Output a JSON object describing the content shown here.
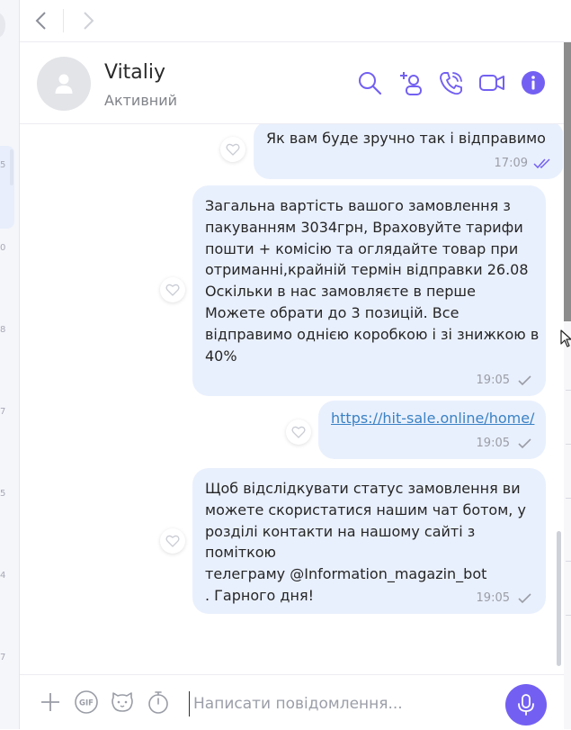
{
  "sidebar_numbers": [
    "5",
    "0",
    "8",
    "7",
    "5",
    "4",
    "7"
  ],
  "header": {
    "contact_name": "Vitaliy",
    "contact_status": "Активний",
    "icons": [
      "search-icon",
      "add-participant-icon",
      "voice-call-icon",
      "video-call-icon",
      "info-icon"
    ]
  },
  "messages": [
    {
      "text": "Як вам буде зручно так і відправимо",
      "time": "17:09",
      "status": "seen"
    },
    {
      "text": "Загальна вартість вашого замовлення з\nпакуванням 3034грн, Враховуйте тарифи\nпошти + комісію  та оглядайте товар при\nотриманні,крайній термін відправки 26.08\nОскільки в нас замовляєте в перше\nМожете обрати до 3 позицій. Все\nвідправимо однією коробкою і зі знижкою в\n40%",
      "time": "19:05",
      "status": "delivered"
    },
    {
      "link": "https://hit-sale.online/home/",
      "time": "19:05",
      "status": "delivered"
    },
    {
      "text": "Щоб відслідкувати статус замовлення ви\nможете скористатися нашим чат ботом, у\nрозділі контакти на нашому сайті з поміткою\nтелеграму @Information_magazin_bot\n. Гарного дня!",
      "time": "19:05",
      "status": "delivered"
    }
  ],
  "composer": {
    "placeholder": "Написати повідомлення...",
    "gif_label": "GIF",
    "icons": [
      "plus-icon",
      "gif-icon",
      "sticker-icon",
      "timer-icon",
      "microphone-icon"
    ]
  },
  "colors": {
    "accent": "#7360f2",
    "bubble": "#e9f0fd",
    "link": "#3b82c4"
  }
}
